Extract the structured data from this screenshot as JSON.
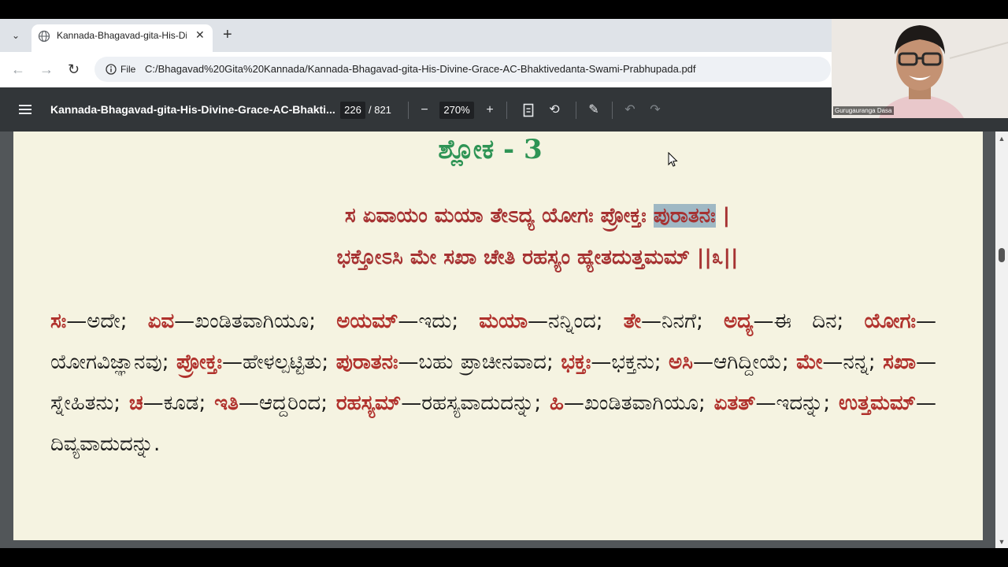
{
  "browser": {
    "tab_title": "Kannada-Bhagavad-gita-His-Divine-Grace-AC-Bhaktivedanta-Swami-Prabhupada.pdf",
    "omnibox": {
      "scheme_label": "File",
      "url": "C:/Bhagavad%20Gita%20Kannada/Kannada-Bhagavad-gita-His-Divine-Grace-AC-Bhaktivedanta-Swami-Prabhupada.pdf"
    }
  },
  "pdf_toolbar": {
    "title": "Kannada-Bhagavad-gita-His-Divine-Grace-AC-Bhakti...",
    "page_current": "226",
    "page_total": "/ 821",
    "zoom": "270%"
  },
  "pdf_page": {
    "heading": "ಶ್ಲೋಕ - 3",
    "verse_line1_before": "ಸ ಏವಾಯಂ ಮಯಾ ತೇಽದ್ಯ ಯೋಗಃ ಪ್ರೋಕ್ತಃ ",
    "verse_line1_highlight": "ಪುರಾತನಃ",
    "verse_line1_after": " |",
    "verse_line2": "ಭಕ್ತೋಽಸಿ ಮೇ ಸಖಾ ಚೇತಿ ರಹಸ್ಯಂ ಹ್ಯೇತದುತ್ತಮಮ್ ||೩||",
    "synonyms": [
      {
        "word": "ಸಃ",
        "meaning": "—ಅದೇ; "
      },
      {
        "word": "ಏವ",
        "meaning": "—ಖಂಡಿತವಾಗಿಯೂ; "
      },
      {
        "word": "ಅಯಮ್",
        "meaning": "—ಇದು; "
      },
      {
        "word": "ಮಯಾ",
        "meaning": "—ನನ್ನಿಂದ; "
      },
      {
        "word": "ತೇ",
        "meaning": "—ನಿನಗೆ; "
      },
      {
        "word": "ಅದ್ಯ",
        "meaning": "—ಈ ದಿನ; "
      },
      {
        "word": "ಯೋಗಃ",
        "meaning": "—ಯೋಗವಿಜ್ಞಾನವು; "
      },
      {
        "word": "ಪ್ರೋಕ್ತಃ",
        "meaning": "—ಹೇಳಲ್ಪಟ್ಟಿತು; "
      },
      {
        "word": "ಪುರಾತನಃ",
        "meaning": "—ಬಹು ಪ್ರಾಚೀನವಾದ; "
      },
      {
        "word": "ಭಕ್ತಃ",
        "meaning": "—ಭಕ್ತನು; "
      },
      {
        "word": "ಅಸಿ",
        "meaning": "—ಆಗಿದ್ದೀಯೆ; "
      },
      {
        "word": "ಮೇ",
        "meaning": "—ನನ್ನ; "
      },
      {
        "word": "ಸಖಾ",
        "meaning": "—ಸ್ನೇಹಿತನು; "
      },
      {
        "word": "ಚ",
        "meaning": "—ಕೂಡ; "
      },
      {
        "word": "ಇತಿ",
        "meaning": "—ಆದ್ದರಿಂದ; "
      },
      {
        "word": "ರಹಸ್ಯಮ್",
        "meaning": "—ರಹಸ್ಯವಾದುದನ್ನು; "
      },
      {
        "word": "ಹಿ",
        "meaning": "—ಖಂಡಿತವಾಗಿಯೂ; "
      },
      {
        "word": "ಏತತ್",
        "meaning": "—ಇದನ್ನು; "
      },
      {
        "word": "ಉತ್ತಮಮ್",
        "meaning": "—ದಿವ್ಯವಾದುದನ್ನು."
      }
    ]
  },
  "webcam": {
    "participant_name": "Gurugauranga Dasa"
  }
}
